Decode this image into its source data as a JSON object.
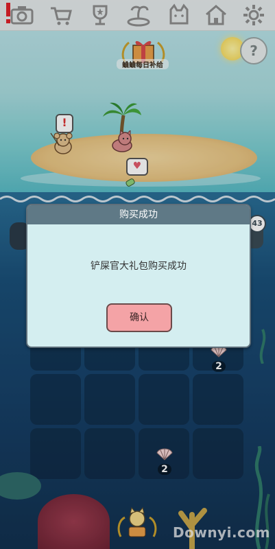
{
  "topbar": {
    "alert": "!",
    "icons": [
      "camera-icon",
      "cart-icon",
      "trophy-icon",
      "island-icon",
      "cat-icon",
      "house-icon",
      "gear-icon"
    ]
  },
  "gift": {
    "label": "蛐蛐每日补给"
  },
  "help": {
    "symbol": "?"
  },
  "scene": {
    "mouse_bubble": "!",
    "badge_count": "43"
  },
  "grid": {
    "shells": [
      {
        "count": "2"
      },
      {
        "count": "2"
      }
    ]
  },
  "dialog": {
    "title": "购买成功",
    "message": "铲屎官大礼包购买成功",
    "confirm_label": "确认"
  },
  "watermark": "Downyi.com",
  "colors": {
    "dialog_bg": "#d4eef0",
    "dialog_header": "#5f7986",
    "confirm_button": "#f4a3a6"
  }
}
